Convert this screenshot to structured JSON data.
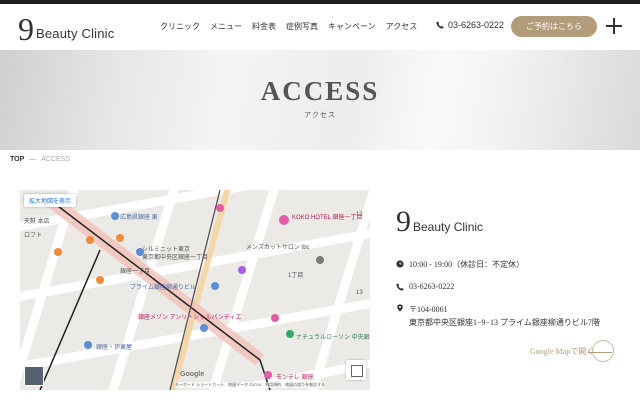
{
  "header": {
    "logo_mark": "9",
    "logo_text": "Beauty Clinic",
    "nav": [
      "クリニック",
      "メニュー",
      "料金表",
      "症例写真",
      "キャンペーン",
      "アクセス"
    ],
    "phone": "03-6263-0222",
    "reserve_label": "ご予約はこちら"
  },
  "hero": {
    "title": "ACCESS",
    "subtitle": "アクセス"
  },
  "breadcrumb": {
    "home": "TOP",
    "separator": "—",
    "current": "ACCESS"
  },
  "map": {
    "enlarge_label": "拡大地図を表示",
    "google": "Google",
    "footer": "キーボード ショートカット　地図データ ©2024　利用規約　地図の誤りを報告する",
    "labels": {
      "l1": "広島県銀座 東",
      "l2": "天麩 本店",
      "l3": "ロフト",
      "l4": "シルミニット東京",
      "l5": "東京都中央区銀座一丁目",
      "l6": "銀座一丁目",
      "l7": "メンズカットサロン tbc",
      "l8": "ブライム銀座柳通りビル",
      "l9": "KOKO HOTEL 銀座一丁目",
      "l10": "1丁目",
      "l11": "銀座メゾン アンリ・シャルパンティエ",
      "l12": "銀座・伊東屋",
      "l13": "ナチュラルローソン 中央銀座一丁目店",
      "l14": "モンテレ 銀座",
      "n12": "12",
      "n13": "13"
    }
  },
  "info": {
    "logo_mark": "9",
    "logo_text": "Beauty Clinic",
    "hours": "10:00 - 19:00（休診日：不定休）",
    "phone": "03-6263-0222",
    "zip": "〒104-0061",
    "address": "東京都中央区銀座1−9−13 プライム銀座柳通りビル7階",
    "gmap_label": "Google Mapで開く"
  },
  "colors": {
    "accent": "#b39c7a",
    "text": "#333333"
  }
}
